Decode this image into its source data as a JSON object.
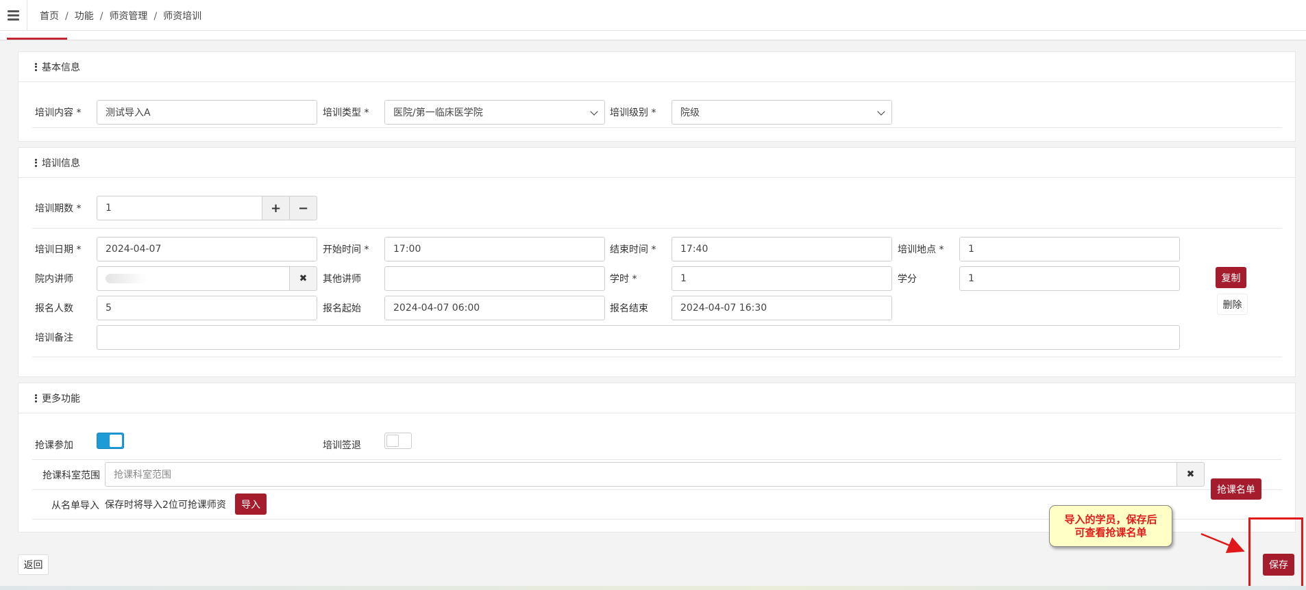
{
  "breadcrumb": [
    "首页",
    "功能",
    "师资管理",
    "师资培训"
  ],
  "breadcrumb_sep": "/",
  "sections": {
    "basic": "基本信息",
    "training": "培训信息",
    "more": "更多功能"
  },
  "basic": {
    "content_label": "培训内容 *",
    "content_value": "测试导入A",
    "type_label": "培训类型 *",
    "type_value": "医院/第一临床医学院",
    "level_label": "培训级别 *",
    "level_value": "院级"
  },
  "training": {
    "periods_label": "培训期数 *",
    "periods_value": "1",
    "plus": "+",
    "minus": "−",
    "date_label": "培训日期 *",
    "date_value": "2024-04-07",
    "start_label": "开始时间 *",
    "start_value": "17:00",
    "end_label": "结束时间 *",
    "end_value": "17:40",
    "place_label": "培训地点 *",
    "place_value": "1",
    "inner_teacher_label": "院内讲师",
    "clear": "✖",
    "other_teacher_label": "其他讲师",
    "other_teacher_value": "",
    "hours_label": "学时 *",
    "hours_value": "1",
    "credit_label": "学分",
    "credit_value": "1",
    "signup_count_label": "报名人数",
    "signup_count_value": "5",
    "signup_start_label": "报名起始",
    "signup_start_value": "2024-04-07 06:00",
    "signup_end_label": "报名结束",
    "signup_end_value": "2024-04-07 16:30",
    "remark_label": "培训备注",
    "remark_value": "",
    "copy_button": "复制",
    "delete_button": "删除"
  },
  "more": {
    "grab_label": "抢课参加",
    "grab_on": true,
    "signout_label": "培训签退",
    "signout_on": false,
    "dept_range_label": "抢课科室范围",
    "dept_range_placeholder": "抢课科室范围",
    "clear": "✖",
    "import_label": "从名单导入",
    "import_hint": "保存时将导入2位可抢课师资",
    "import_button": "导入",
    "grab_list_button": "抢课名单"
  },
  "footer": {
    "back_button": "返回",
    "save_button": "保存"
  },
  "annotation": {
    "line1": "导入的学员，保存后",
    "line2": "可查看抢课名单"
  },
  "colors": {
    "accent_red": "#a51d2d",
    "toggle_blue": "#1e9bd7",
    "annotation_red": "#e01818"
  }
}
